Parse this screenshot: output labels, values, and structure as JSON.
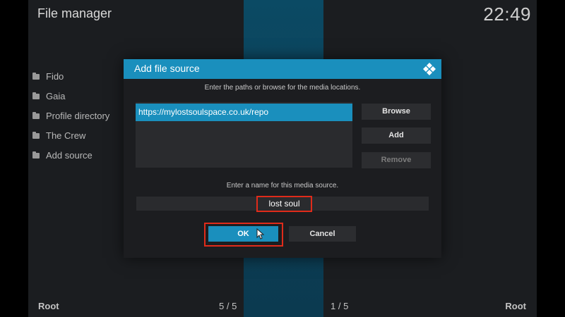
{
  "window": {
    "title": "File manager",
    "clock": "22:49"
  },
  "sidebar": {
    "items": [
      {
        "label": "Fido",
        "icon": "folder-icon"
      },
      {
        "label": "Gaia",
        "icon": "folder-icon"
      },
      {
        "label": "Profile directory",
        "icon": "folder-icon"
      },
      {
        "label": "The Crew",
        "icon": "folder-icon"
      },
      {
        "label": "Add source",
        "icon": "folder-icon"
      }
    ]
  },
  "footer": {
    "left_root": "Root",
    "left_count": "5 / 5",
    "right_count": "1 / 5",
    "right_root": "Root"
  },
  "dialog": {
    "title": "Add file source",
    "logo_icon": "kodi-logo-icon",
    "paths_hint": "Enter the paths or browse for the media locations.",
    "paths": [
      "https://mylostsoulspace.co.uk/repo"
    ],
    "browse_label": "Browse",
    "add_label": "Add",
    "remove_label": "Remove",
    "name_hint": "Enter a name for this media source.",
    "name_value": "lost soul",
    "ok_label": "OK",
    "cancel_label": "Cancel"
  },
  "colors": {
    "accent": "#1a8fbd",
    "highlight": "#e02b1a",
    "panel": "#1c1d20"
  }
}
